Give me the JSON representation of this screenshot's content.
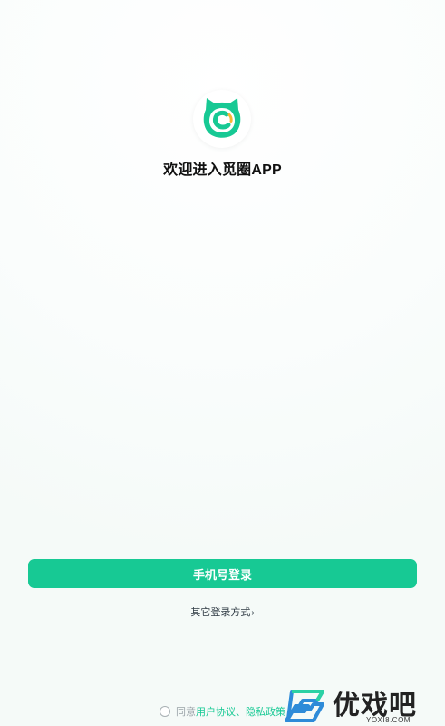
{
  "app": {
    "welcome_text": "欢迎进入觅圈APP",
    "logo_icon": "cat-circle-logo-icon",
    "brand_color": "#17c994",
    "accent_color": "#f7b733"
  },
  "login": {
    "phone_login_label": "手机号登录",
    "other_methods_label": "其它登录方式",
    "other_methods_chevron": "›"
  },
  "agreement": {
    "prefix": "同意",
    "user_agreement": "用户协议",
    "separator": "、",
    "privacy_policy": "隐私政策"
  },
  "watermark": {
    "text": "优戏吧",
    "url": "YOXI8.COM"
  }
}
